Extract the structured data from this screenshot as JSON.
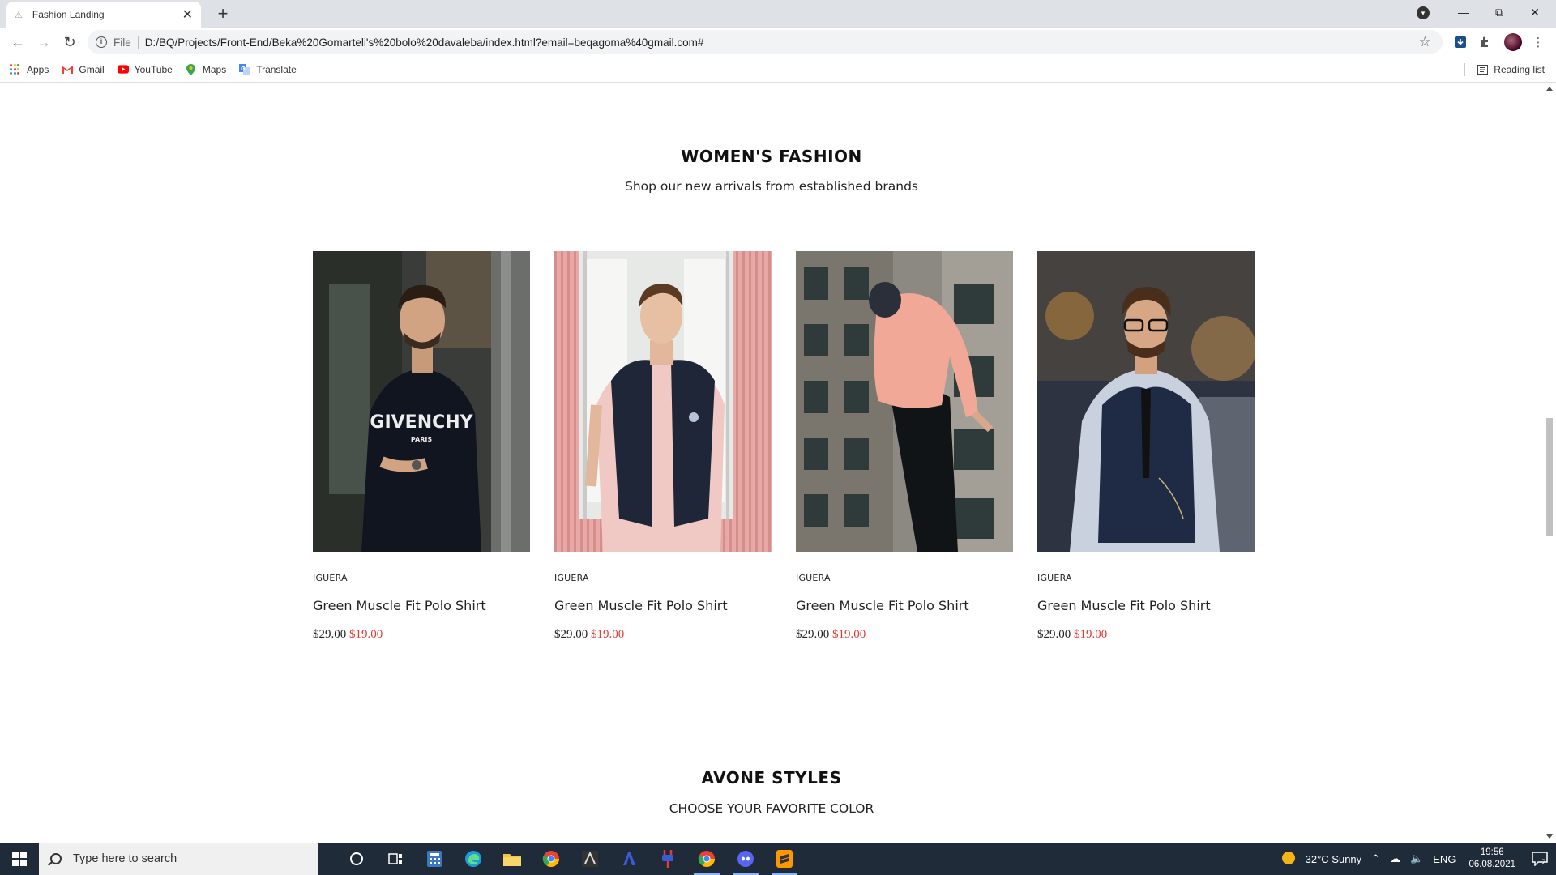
{
  "browser": {
    "tab_title": "Fashion Landing",
    "url_scheme_label": "File",
    "url": "D:/BQ/Projects/Front-End/Beka%20Gomarteli's%20bolo%20davaleba/index.html?email=beqagoma%40gmail.com#",
    "bookmarks": [
      "Apps",
      "Gmail",
      "YouTube",
      "Maps",
      "Translate"
    ],
    "reading_list": "Reading list"
  },
  "womens_section": {
    "title": "WOMEN'S FASHION",
    "subtitle": "Shop our new arrivals from established brands"
  },
  "products": [
    {
      "brand": "IGUERA",
      "name": "Green Muscle Fit Polo Shirt",
      "old_price": "$29.00",
      "new_price": "$19.00"
    },
    {
      "brand": "IGUERA",
      "name": "Green Muscle Fit Polo Shirt",
      "old_price": "$29.00",
      "new_price": "$19.00"
    },
    {
      "brand": "IGUERA",
      "name": "Green Muscle Fit Polo Shirt",
      "old_price": "$29.00",
      "new_price": "$19.00"
    },
    {
      "brand": "IGUERA",
      "name": "Green Muscle Fit Polo Shirt",
      "old_price": "$29.00",
      "new_price": "$19.00"
    }
  ],
  "product_images": {
    "img1_text_main": "GIVENCHY",
    "img1_text_sub": "PARIS"
  },
  "styles_section": {
    "title": "AVONE STYLES",
    "subtitle": "CHOOSE YOUR FAVORITE COLOR"
  },
  "taskbar": {
    "search_placeholder": "Type here to search",
    "weather": "32°C  Sunny",
    "language": "ENG",
    "time": "19:56",
    "date": "06.08.2021",
    "notification_count": "2"
  },
  "colors": {
    "sale_price": "#e53935",
    "taskbar_bg": "#202b3a"
  }
}
